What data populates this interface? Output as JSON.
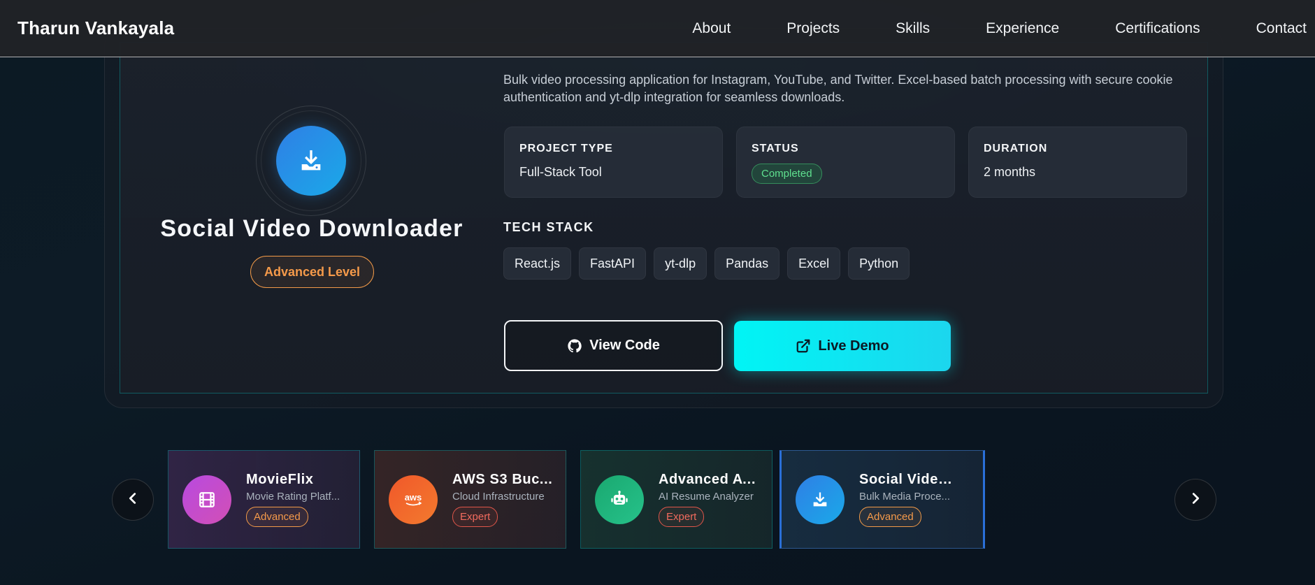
{
  "navbar": {
    "brand": "Tharun Vankayala",
    "links": [
      "About",
      "Projects",
      "Skills",
      "Experience",
      "Certifications",
      "Contact"
    ]
  },
  "project": {
    "title": "Social Video Downloader",
    "level": "Advanced Level",
    "icon": "download-icon",
    "description": "Bulk video processing application for Instagram, YouTube, and Twitter. Excel-based batch processing with secure cookie authentication and yt-dlp integration for seamless downloads.",
    "info": [
      {
        "label": "PROJECT TYPE",
        "value": "Full-Stack Tool"
      },
      {
        "label": "STATUS",
        "value": "Completed"
      },
      {
        "label": "DURATION",
        "value": "2 months"
      }
    ],
    "tech_heading": "TECH STACK",
    "tech": [
      "React.js",
      "FastAPI",
      "yt-dlp",
      "Pandas",
      "Excel",
      "Python"
    ],
    "view_code_label": "View Code",
    "live_demo_label": "Live Demo"
  },
  "carousel": {
    "items": [
      {
        "title": "MovieFlix",
        "subtitle": "Movie Rating Platf...",
        "badge": "Advanced",
        "icon": "film-icon",
        "color": "#b04ad8"
      },
      {
        "title": "AWS S3 Buc...",
        "subtitle": "Cloud Infrastructure",
        "badge": "Expert",
        "icon": "aws-icon",
        "color": "#f0582a"
      },
      {
        "title": "Advanced AT...",
        "subtitle": "AI Resume Analyzer",
        "badge": "Expert",
        "icon": "robot-icon",
        "color": "#1fb57a"
      },
      {
        "title": "Social Video ...",
        "subtitle": "Bulk Media Proce...",
        "badge": "Advanced",
        "icon": "download-icon",
        "color": "#2a86e0"
      }
    ]
  },
  "colors": {
    "accent": "#00f5f5",
    "advanced": "#f59a4a",
    "expert": "#f26b5e",
    "completed": "#5fe08f"
  }
}
